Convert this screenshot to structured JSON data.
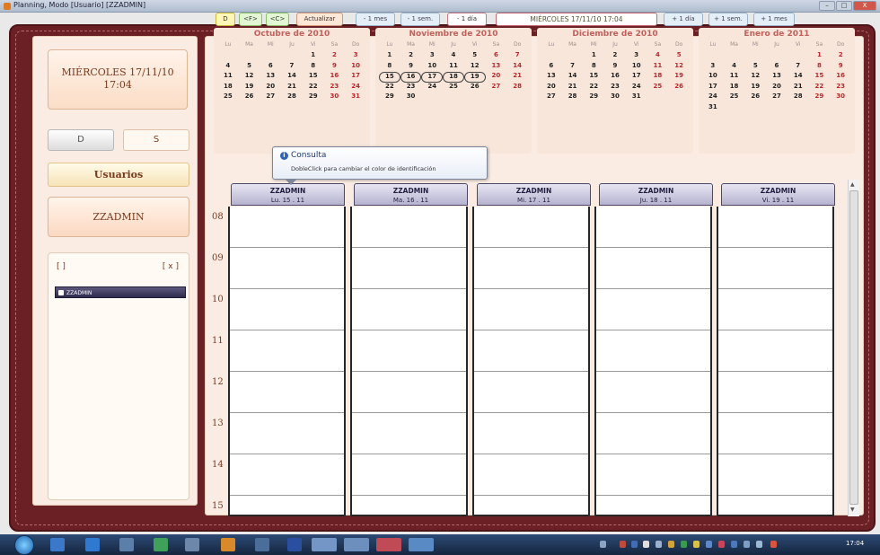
{
  "window": {
    "title": "Planning, Modo [Usuario] [ZZADMIN]",
    "controls": [
      "–",
      "□",
      "X"
    ]
  },
  "left_panel": {
    "date_line1": "MIÉRCOLES 17/11/10",
    "date_line2": "17:04",
    "btn_d": "D",
    "btn_s": "S",
    "usuarios": "Usuarios",
    "user": "ZZADMIN",
    "list_btn1": "[ ]",
    "list_btn2": "[ x ]",
    "list_item": "ZZADMIN"
  },
  "toolbar": {
    "d": "D",
    "ifr": "<F>",
    "ic": "<C>",
    "actualizar": "Actualizar",
    "minus_mes": "- 1 mes",
    "minus_sem": "- 1 sem.",
    "minus_dia": "- 1 día",
    "current": "MIÉRCOLES 17/11/10 17:04",
    "plus_dia": "+ 1 día",
    "plus_sem": "+ 1 sem.",
    "plus_mes": "+ 1 mes"
  },
  "calendars": [
    {
      "title": "Octubre de 2010",
      "days_names": [
        "Lu",
        "Ma",
        "Mi",
        "Ju",
        "Vi",
        "Sa",
        "Do"
      ],
      "offset": 4,
      "days": [
        "1",
        "2",
        "3",
        "4",
        "5",
        "6",
        "7",
        "8",
        "9",
        "10",
        "11",
        "12",
        "13",
        "14",
        "15",
        "16",
        "17",
        "18",
        "19",
        "20",
        "21",
        "22",
        "23",
        "24",
        "25",
        "26",
        "27",
        "28",
        "29",
        "30",
        "31"
      ]
    },
    {
      "title": "Noviembre de 2010",
      "days_names": [
        "Lu",
        "Ma",
        "Mi",
        "Ju",
        "Vi",
        "Sa",
        "Do"
      ],
      "offset": 0,
      "days": [
        "1",
        "2",
        "3",
        "4",
        "5",
        "6",
        "7",
        "8",
        "9",
        "10",
        "11",
        "12",
        "13",
        "14",
        "15",
        "16",
        "17",
        "18",
        "19",
        "20",
        "21",
        "22",
        "23",
        "24",
        "25",
        "26",
        "27",
        "28",
        "29",
        "30"
      ]
    },
    {
      "title": "Diciembre de 2010",
      "days_names": [
        "Lu",
        "Ma",
        "Mi",
        "Ju",
        "Vi",
        "Sa",
        "Do"
      ],
      "offset": 2,
      "days": [
        "1",
        "2",
        "3",
        "4",
        "5",
        "6",
        "7",
        "8",
        "9",
        "10",
        "11",
        "12",
        "13",
        "14",
        "15",
        "16",
        "17",
        "18",
        "19",
        "20",
        "21",
        "22",
        "23",
        "24",
        "25",
        "26",
        "27",
        "28",
        "29",
        "30",
        "31"
      ]
    },
    {
      "title": "Enero de 2011",
      "days_names": [
        "Lu",
        "Ma",
        "Mi",
        "Ju",
        "Vi",
        "Sa",
        "Do"
      ],
      "offset": 5,
      "days": [
        "1",
        "2",
        "3",
        "4",
        "5",
        "6",
        "7",
        "8",
        "9",
        "10",
        "11",
        "12",
        "13",
        "14",
        "15",
        "16",
        "17",
        "18",
        "19",
        "20",
        "21",
        "22",
        "23",
        "24",
        "25",
        "26",
        "27",
        "28",
        "29",
        "30",
        "31"
      ]
    }
  ],
  "tooltip": {
    "title": "Consulta",
    "text": "DobleClick para cambiar el color de identificación"
  },
  "columns": [
    {
      "user": "ZZADMIN",
      "date": "Lu. 15 . 11"
    },
    {
      "user": "ZZADMIN",
      "date": "Ma. 16 . 11"
    },
    {
      "user": "ZZADMIN",
      "date": "Mi. 17 . 11"
    },
    {
      "user": "ZZADMIN",
      "date": "Ju. 18 . 11"
    },
    {
      "user": "ZZADMIN",
      "date": "Vi. 19 . 11"
    }
  ],
  "hours": [
    "08",
    "09",
    "10",
    "11",
    "12",
    "13",
    "14",
    "15"
  ],
  "taskbar": {
    "clock": "17:04"
  }
}
